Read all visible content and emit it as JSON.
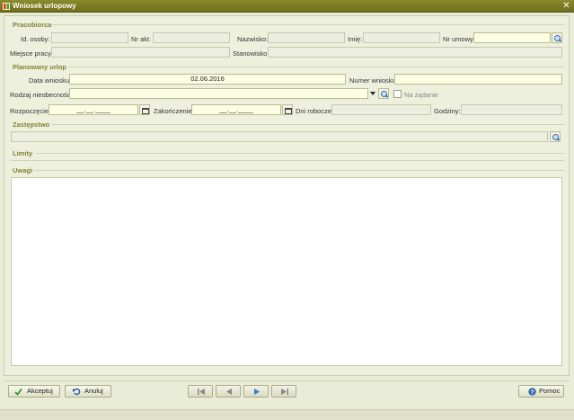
{
  "window": {
    "title": "Wniosek urlopowy"
  },
  "sections": {
    "employee": "Pracobiorca",
    "planned_leave": "Planowany urlop",
    "substitution": "Zastępstwo",
    "limits": "Limity",
    "notes": "Uwagi"
  },
  "employee": {
    "id_label": "Id. osoby:",
    "id_value": "",
    "nr_akt_label": "Nr akt:",
    "nr_akt_value": "",
    "surname_label": "Nazwisko:",
    "surname_value": "",
    "name_label": "Imię:",
    "name_value": "",
    "contract_label": "Nr umowy:",
    "contract_value": "",
    "workplace_label": "Miejsce pracy:",
    "workplace_value": "",
    "position_label": "Stanowisko:",
    "position_value": ""
  },
  "leave": {
    "date_label": "Data wniosku:",
    "date_value": "02.06.2016",
    "number_label": "Numer wniosku:",
    "number_value": "",
    "type_label": "Rodzaj nieobecności:",
    "type_value": "",
    "on_demand_label": "Na żądanie",
    "start_label": "Rozpoczęcie:",
    "start_value": "__.__.____",
    "end_label": "Zakończenie:",
    "end_value": "__.__.____",
    "workdays_label": "Dni robocze:",
    "workdays_value": "",
    "hours_label": "Godziny:",
    "hours_value": ""
  },
  "buttons": {
    "accept": "Akceptuj",
    "cancel": "Anuluj",
    "help": "Pomoc"
  },
  "icons": {
    "search": "search-icon",
    "calendar": "calendar-icon",
    "dropdown": "chevron-down-icon"
  },
  "colors": {
    "titlebar": "#7d7d26",
    "section_title": "#7d8430",
    "edit_field": "#fdfde4"
  }
}
